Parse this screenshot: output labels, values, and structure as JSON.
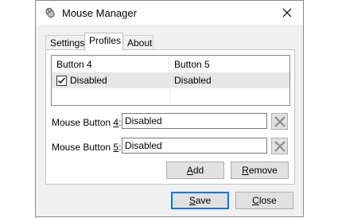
{
  "window": {
    "title": "Mouse Manager",
    "icon": "mouse-icon",
    "close_glyph": "✕"
  },
  "tabs": [
    {
      "label": "Settings"
    },
    {
      "label": "Profiles",
      "active": true
    },
    {
      "label": "About"
    }
  ],
  "profiles": {
    "columns": [
      "Button 4",
      "Button 5"
    ],
    "rows": [
      {
        "checked": true,
        "button4": "Disabled",
        "button5": "Disabled"
      }
    ]
  },
  "fields": {
    "button4": {
      "label_prefix": "Mouse Button ",
      "label_key": "4",
      "label_suffix": ":",
      "value": "Disabled"
    },
    "button5": {
      "label_prefix": "Mouse Button ",
      "label_key": "5",
      "label_suffix": ":",
      "value": "Disabled"
    }
  },
  "buttons": {
    "add": {
      "key": "A",
      "rest": "dd"
    },
    "remove": {
      "key": "R",
      "rest": "emove"
    },
    "save": {
      "key": "S",
      "rest": "ave"
    },
    "close": {
      "key": "C",
      "rest": "lose"
    }
  },
  "colors": {
    "selected_row": "#e6e6e6",
    "default_button_border": "#0078d7",
    "dialog_background": "#f0f0f0"
  }
}
